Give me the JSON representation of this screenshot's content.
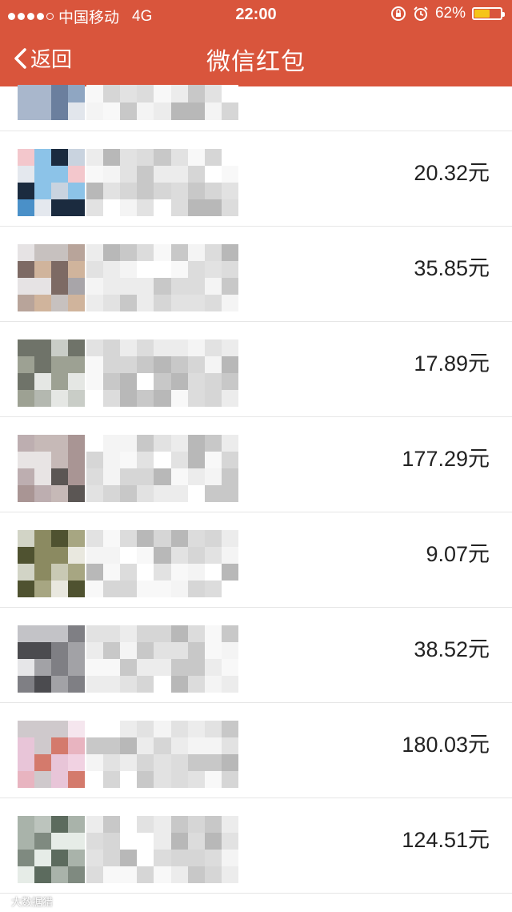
{
  "status_bar": {
    "carrier": "中国移动",
    "network": "4G",
    "time": "22:00",
    "battery": "62%",
    "battery_level": 0.62
  },
  "nav": {
    "back_label": "返回",
    "title": "微信红包"
  },
  "amounts": [
    "20.32元",
    "35.85元",
    "17.89元",
    "177.29元",
    "9.07元",
    "38.52元",
    "180.03元",
    "124.51元"
  ],
  "watermark": "大数据猎",
  "colors": {
    "nav_bg": "#d9553c",
    "battery_fill": "#f5c518",
    "divider": "#e6e6e6"
  }
}
